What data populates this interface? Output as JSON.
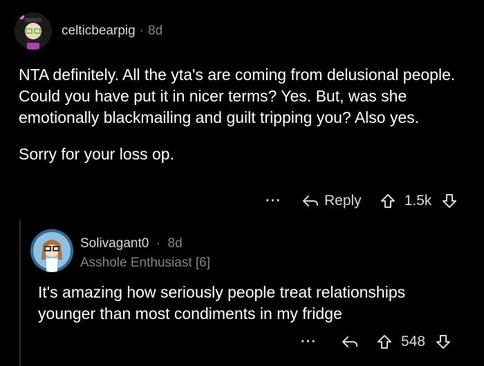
{
  "comment1": {
    "username": "celticbearpig",
    "separator": "·",
    "age": "8d",
    "paragraphs": [
      "NTA definitely. All the yta's are coming from delusional people. Could you have put it in nicer terms? Yes. But, was she emotionally blackmailing and guilt tripping you? Also yes.",
      "Sorry for your loss op."
    ],
    "more_label": "···",
    "reply_label": "Reply",
    "vote_count": "1.5k"
  },
  "comment2": {
    "username": "Solivagant0",
    "separator": "·",
    "age": "8d",
    "flair": "Asshole Enthusiast [6]",
    "text": "It's amazing how seriously people treat relationships younger than most condiments in my fridge",
    "more_label": "···",
    "vote_count": "548"
  },
  "colors": {
    "background": "#000000",
    "text": "#ffffff",
    "meta": "#818384"
  }
}
